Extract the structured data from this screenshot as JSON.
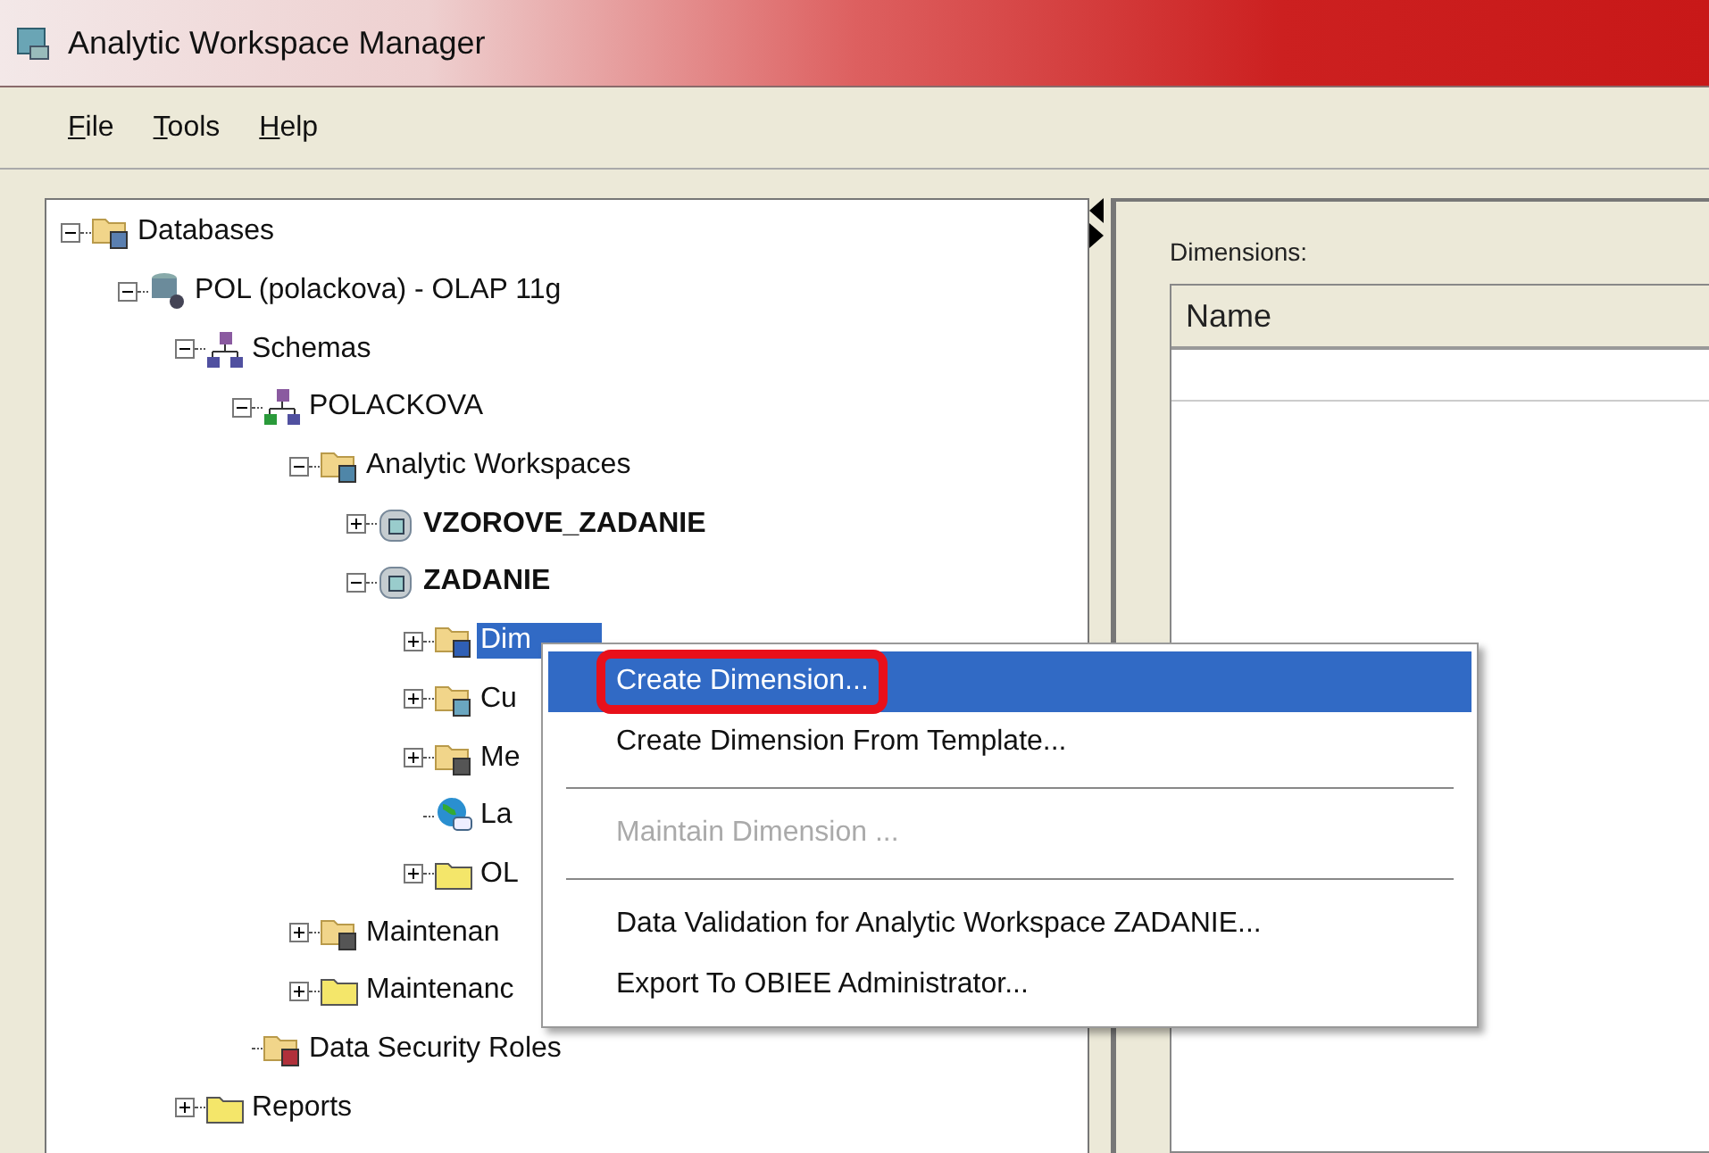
{
  "window": {
    "title": "Analytic Workspace Manager"
  },
  "menu_bar": [
    {
      "label": "File"
    },
    {
      "label": "Tools"
    },
    {
      "label": "Help"
    }
  ],
  "tree": [
    {
      "label": "Databases",
      "kind": "folder-db",
      "expanded": true,
      "bold": false,
      "selected": false,
      "children": [
        {
          "label": "POL (polackova) - OLAP 11g",
          "kind": "server",
          "expanded": true,
          "bold": false,
          "selected": false,
          "children": [
            {
              "label": "Schemas",
              "kind": "schema",
              "expanded": true,
              "bold": false,
              "selected": false,
              "children": [
                {
                  "label": "POLACKOVA",
                  "kind": "network",
                  "expanded": true,
                  "bold": false,
                  "selected": false,
                  "children": [
                    {
                      "label": "Analytic Workspaces",
                      "kind": "folder-aw",
                      "expanded": true,
                      "bold": false,
                      "selected": false,
                      "children": [
                        {
                          "label": "VZOROVE_ZADANIE",
                          "kind": "cube",
                          "expanded": false,
                          "bold": true,
                          "selected": false
                        },
                        {
                          "label": "ZADANIE",
                          "kind": "cube",
                          "expanded": true,
                          "bold": true,
                          "selected": false,
                          "children": [
                            {
                              "label": "Dim",
                              "kind": "folder-dim",
                              "expanded": false,
                              "bold": false,
                              "selected": true
                            },
                            {
                              "label": "Cu",
                              "kind": "folder-cube",
                              "expanded": false,
                              "bold": false,
                              "selected": false
                            },
                            {
                              "label": "Me",
                              "kind": "folder-measure",
                              "expanded": false,
                              "bold": false,
                              "selected": false
                            },
                            {
                              "label": "La",
                              "kind": "globe",
                              "bold": false,
                              "selected": false
                            },
                            {
                              "label": "OL",
                              "kind": "folder",
                              "expanded": false,
                              "bold": false,
                              "selected": false
                            }
                          ]
                        }
                      ]
                    },
                    {
                      "label": "Maintenan",
                      "kind": "folder-calc",
                      "expanded": false,
                      "bold": false,
                      "selected": false
                    },
                    {
                      "label": "Maintenanc",
                      "kind": "folder",
                      "expanded": false,
                      "bold": false,
                      "selected": false
                    }
                  ]
                },
                {
                  "label": "Data Security Roles",
                  "kind": "folder-security",
                  "bold": false,
                  "selected": false
                }
              ]
            },
            {
              "label": "Reports",
              "kind": "folder",
              "expanded": false,
              "bold": false,
              "selected": false
            }
          ]
        }
      ]
    }
  ],
  "context_menu": [
    {
      "kind": "item",
      "label": "Create Dimension...",
      "selected": true,
      "disabled": false,
      "marked": true
    },
    {
      "kind": "item",
      "label": "Create Dimension From Template...",
      "selected": false,
      "disabled": false,
      "marked": false
    },
    {
      "kind": "separator"
    },
    {
      "kind": "item",
      "label": "Maintain Dimension ...",
      "selected": false,
      "disabled": true,
      "marked": false
    },
    {
      "kind": "separator"
    },
    {
      "kind": "item",
      "label": "Data Validation for Analytic Workspace ZADANIE...",
      "selected": false,
      "disabled": false,
      "marked": false
    },
    {
      "kind": "item",
      "label": "Export To OBIEE Administrator...",
      "selected": false,
      "disabled": false,
      "marked": false
    }
  ],
  "detail": {
    "label": "Dimensions:",
    "table": {
      "columns": [
        "Name"
      ]
    }
  }
}
